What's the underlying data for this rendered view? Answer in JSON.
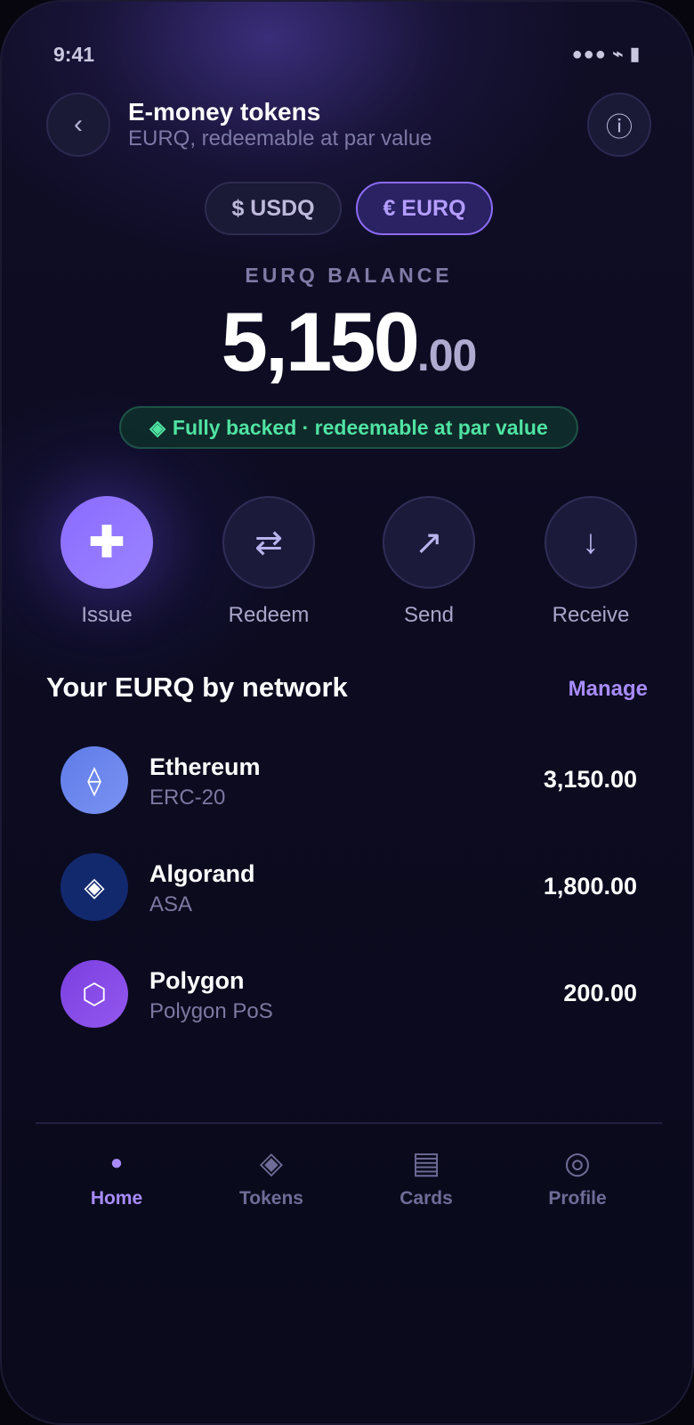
{
  "status_bar": {
    "time": "9:41",
    "icons": "●●● ⌁ ▮"
  },
  "header": {
    "back_icon": "‹",
    "title": "E-money tokens",
    "subtitle": "EURQ, redeemable at par value",
    "info_icon": "ⓘ"
  },
  "currency_toggle": {
    "options": [
      {
        "label": "$ USDQ",
        "selected": false
      },
      {
        "label": "€ EURQ",
        "selected": true
      }
    ]
  },
  "balance": {
    "label": "EURQ BALANCE",
    "integer": "5,150",
    "decimal": ".00",
    "status_icon": "◈",
    "status_text": "Fully backed · redeemable at par value"
  },
  "actions": [
    {
      "label": "Issue",
      "icon": "✚"
    },
    {
      "label": "Redeem",
      "icon": "⇄"
    },
    {
      "label": "Send",
      "icon": "↗"
    },
    {
      "label": "Receive",
      "icon": "↓"
    }
  ],
  "networks_section": {
    "title": "Your EURQ by network",
    "manage_label": "Manage",
    "items": [
      {
        "name": "Ethereum",
        "standard": "ERC-20",
        "amount": "3,150.00",
        "icon": "⟠",
        "color": "#6a86ef"
      },
      {
        "name": "Algorand",
        "standard": "ASA",
        "amount": "1,800.00",
        "icon": "◈",
        "color": "#13296e"
      },
      {
        "name": "Polygon",
        "standard": "Polygon PoS",
        "amount": "200.00",
        "icon": "⬡",
        "color": "#8148e6"
      }
    ]
  },
  "tab_bar": {
    "items": [
      {
        "label": "Home",
        "icon": "●",
        "active": true
      },
      {
        "label": "Tokens",
        "icon": "◈",
        "active": false
      },
      {
        "label": "Cards",
        "icon": "▤",
        "active": false
      },
      {
        "label": "Profile",
        "icon": "◎",
        "active": false
      }
    ]
  },
  "colors": {
    "accent": "#8b6cf6",
    "accent_text": "#a88cff",
    "success": "#4fe3a2",
    "background": "#0a0a1c"
  }
}
